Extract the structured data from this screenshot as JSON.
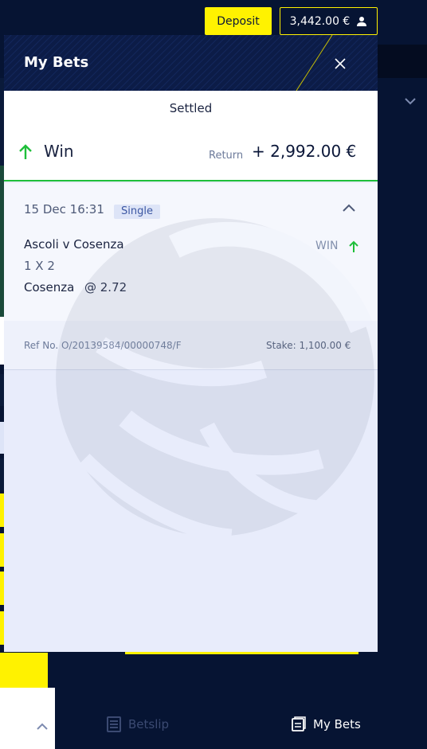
{
  "header": {
    "deposit_label": "Deposit",
    "balance": "3,442.00 €"
  },
  "panel": {
    "title": "My Bets",
    "tab": "Settled"
  },
  "result": {
    "label": "Win",
    "return_label": "Return",
    "return_value": "+ 2,992.00 €"
  },
  "bet": {
    "date": "15 Dec 16:31",
    "type": "Single",
    "event": "Ascoli v Cosenza",
    "market": "1 X 2",
    "selection": "Cosenza",
    "odds": "@ 2.72",
    "status": "WIN",
    "ref": "Ref No. O/20139584/00000748/F",
    "stake": "Stake: 1,100.00 €"
  },
  "nav": {
    "betslip": "Betslip",
    "mybets": "My Bets"
  },
  "colors": {
    "accent_yellow": "#fff200",
    "win_green": "#1fbf3a",
    "navy": "#061433"
  },
  "icons": [
    "user-icon",
    "close-icon",
    "arrow-up-icon",
    "chevron-up-icon",
    "chevron-down-icon",
    "betslip-icon",
    "mybets-icon"
  ]
}
